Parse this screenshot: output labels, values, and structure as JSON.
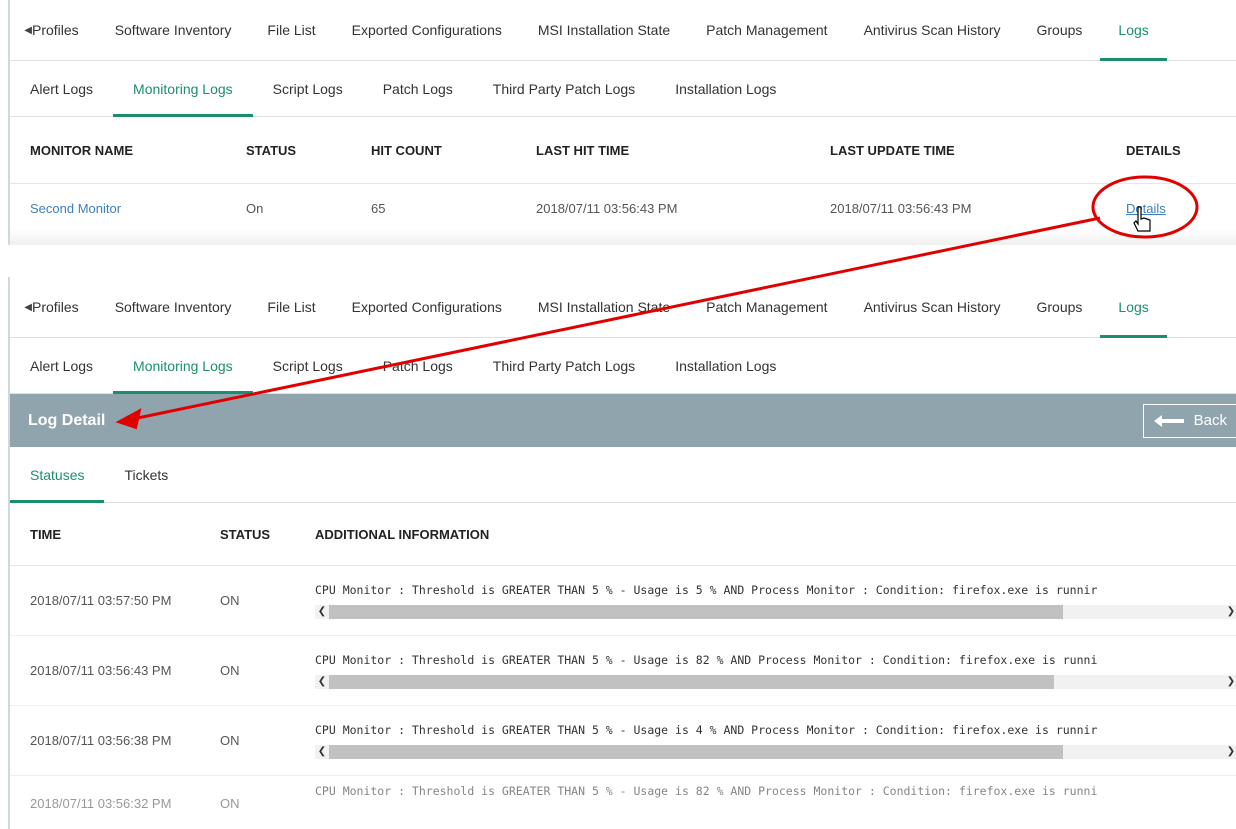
{
  "top_tabs": [
    "Profiles",
    "Software Inventory",
    "File List",
    "Exported Configurations",
    "MSI Installation State",
    "Patch Management",
    "Antivirus Scan History",
    "Groups",
    "Logs"
  ],
  "top_tabs_active": "Logs",
  "sub_tabs": [
    "Alert Logs",
    "Monitoring Logs",
    "Script Logs",
    "Patch Logs",
    "Third Party Patch Logs",
    "Installation Logs"
  ],
  "sub_tabs_active": "Monitoring Logs",
  "monitor_table": {
    "headers": [
      "MONITOR NAME",
      "STATUS",
      "HIT COUNT",
      "LAST HIT TIME",
      "LAST UPDATE TIME",
      "DETAILS"
    ],
    "rows": [
      {
        "name": "Second Monitor",
        "status": "On",
        "hit_count": "65",
        "last_hit": "2018/07/11 03:56:43 PM",
        "last_update": "2018/07/11 03:56:43 PM",
        "details": "Details"
      }
    ]
  },
  "log_detail": {
    "title": "Log Detail",
    "back_label": "Back",
    "tabs": [
      "Statuses",
      "Tickets"
    ],
    "active_tab": "Statuses",
    "headers": [
      "TIME",
      "STATUS",
      "ADDITIONAL INFORMATION"
    ],
    "rows": [
      {
        "time": "2018/07/11 03:57:50 PM",
        "status": "ON",
        "info": "CPU Monitor : Threshold is GREATER THAN 5 % - Usage is 5 % AND Process Monitor : Condition: firefox.exe is runnir"
      },
      {
        "time": "2018/07/11 03:56:43 PM",
        "status": "ON",
        "info": "CPU Monitor : Threshold is GREATER THAN 5 % - Usage is 82 % AND Process Monitor : Condition: firefox.exe is runni"
      },
      {
        "time": "2018/07/11 03:56:38 PM",
        "status": "ON",
        "info": "CPU Monitor : Threshold is GREATER THAN 5 % - Usage is 4 % AND Process Monitor : Condition: firefox.exe is runnir"
      },
      {
        "time": "2018/07/11 03:56:32 PM",
        "status": "ON",
        "info": "CPU Monitor : Threshold is GREATER THAN 5 % - Usage is 82 % AND Process Monitor : Condition: firefox.exe is runni"
      }
    ]
  },
  "colors": {
    "accent": "#1a8f6f",
    "link": "#3c7fc1",
    "header_band": "#90a4ae",
    "annotation": "#e00000"
  }
}
